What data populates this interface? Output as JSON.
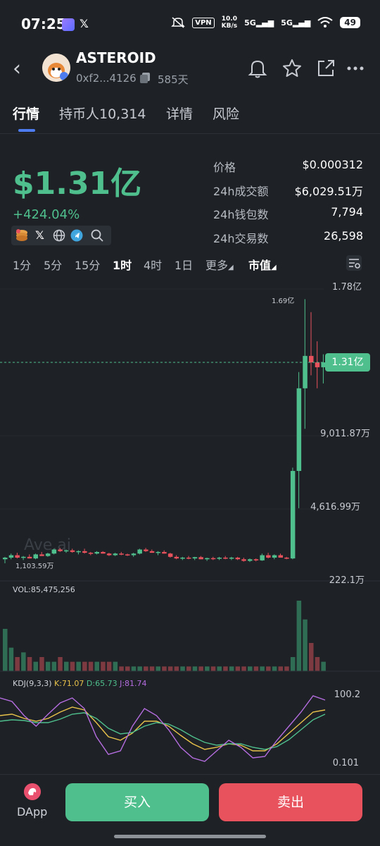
{
  "status_bar": {
    "time": "07:25",
    "vpn": "VPN",
    "net_speed": "10.0",
    "net_unit": "KB/s",
    "sig1": "5G",
    "sig2": "5G",
    "battery": "49",
    "icons": [
      "app-icon",
      "x-icon",
      "mute-icon",
      "signal-icon",
      "wifi-icon",
      "battery-icon"
    ]
  },
  "header": {
    "token_name": "ASTEROID",
    "address": "0xf2...4126",
    "age": "585天",
    "icons": [
      "back-icon",
      "bell-icon",
      "star-icon",
      "share-icon",
      "more-icon"
    ]
  },
  "tabs": [
    {
      "label": "行情",
      "active": true
    },
    {
      "label": "持币人10,314",
      "active": false
    },
    {
      "label": "详情",
      "active": false
    },
    {
      "label": "风险",
      "active": false
    }
  ],
  "summary": {
    "market_cap": "$1.31亿",
    "change": "+424.04%",
    "stats": [
      {
        "label": "价格",
        "value": "$0.000312"
      },
      {
        "label": "24h成交额",
        "value": "$6,029.51万"
      },
      {
        "label": "24h钱包数",
        "value": "7,794"
      },
      {
        "label": "24h交易数",
        "value": "26,598"
      }
    ],
    "social_icons": [
      "coin-stack-icon",
      "x-icon",
      "globe-icon",
      "telegram-icon",
      "search-icon"
    ]
  },
  "intervals": [
    {
      "label": "1分",
      "active": false
    },
    {
      "label": "5分",
      "active": false
    },
    {
      "label": "15分",
      "active": false
    },
    {
      "label": "1时",
      "active": true
    },
    {
      "label": "4时",
      "active": false
    },
    {
      "label": "1日",
      "active": false
    },
    {
      "label": "更多",
      "active": false
    }
  ],
  "metric_select": "市值",
  "chart_data": {
    "type": "candlestick",
    "y_axis_labels": [
      "1.78亿",
      "9,011.87万",
      "4,616.99万",
      "222.1万"
    ],
    "y_axis_values_wan": [
      17800,
      9011.87,
      4616.99,
      222.1
    ],
    "current_value_label": "1.31亿",
    "high_label": "1.69亿",
    "low_label": "1,103.59万",
    "watermark": "Ave.ai",
    "colors": {
      "up": "#4fc08d",
      "down": "#e8525d"
    },
    "candles_wan": [
      [
        950,
        1100,
        700,
        1050
      ],
      [
        1050,
        1300,
        950,
        1200
      ],
      [
        1200,
        1350,
        1000,
        1050
      ],
      [
        1050,
        1150,
        900,
        1100
      ],
      [
        1100,
        1250,
        1000,
        1000
      ],
      [
        1000,
        1300,
        950,
        1250
      ],
      [
        1250,
        1400,
        1150,
        1150
      ],
      [
        1150,
        1350,
        1100,
        1300
      ],
      [
        1300,
        1600,
        1250,
        1550
      ],
      [
        1550,
        1650,
        1400,
        1450
      ],
      [
        1450,
        1550,
        1350,
        1500
      ],
      [
        1500,
        1600,
        1350,
        1400
      ],
      [
        1400,
        1500,
        1250,
        1450
      ],
      [
        1450,
        1600,
        1300,
        1350
      ],
      [
        1350,
        1400,
        1200,
        1300
      ],
      [
        1300,
        1450,
        1250,
        1400
      ],
      [
        1400,
        1450,
        1300,
        1300
      ],
      [
        1300,
        1350,
        1150,
        1200
      ],
      [
        1200,
        1350,
        1150,
        1300
      ],
      [
        1300,
        1400,
        1200,
        1250
      ],
      [
        1250,
        1300,
        1150,
        1200
      ],
      [
        1200,
        1350,
        1100,
        1300
      ],
      [
        1300,
        1600,
        1250,
        1550
      ],
      [
        1550,
        1650,
        1400,
        1450
      ],
      [
        1450,
        1550,
        1350,
        1350
      ],
      [
        1350,
        1450,
        1200,
        1400
      ],
      [
        1400,
        1500,
        1300,
        1300
      ],
      [
        1300,
        1350,
        1050,
        1100
      ],
      [
        1100,
        1200,
        950,
        1000
      ],
      [
        1000,
        1100,
        900,
        1050
      ],
      [
        1050,
        1150,
        950,
        1000
      ],
      [
        1000,
        1100,
        900,
        1080
      ],
      [
        1080,
        1150,
        950,
        950
      ],
      [
        950,
        1050,
        850,
        1020
      ],
      [
        1020,
        1100,
        900,
        980
      ],
      [
        980,
        1100,
        900,
        1050
      ],
      [
        1050,
        1150,
        950,
        1000
      ],
      [
        1000,
        1100,
        900,
        1050
      ],
      [
        1050,
        1100,
        900,
        950
      ],
      [
        950,
        1050,
        800,
        850
      ],
      [
        850,
        1000,
        780,
        950
      ],
      [
        950,
        1000,
        820,
        880
      ],
      [
        880,
        1300,
        850,
        1200
      ],
      [
        1200,
        1350,
        1000,
        1050
      ],
      [
        1050,
        1250,
        950,
        1200
      ],
      [
        1200,
        1300,
        1050,
        1050
      ],
      [
        1050,
        1100,
        950,
        1000
      ],
      [
        1000,
        6600,
        950,
        6400
      ],
      [
        6400,
        12500,
        4100,
        11500
      ],
      [
        11500,
        17000,
        9000,
        13500
      ],
      [
        13500,
        16200,
        12300,
        13100
      ],
      [
        13100,
        14400,
        11500,
        12800
      ],
      [
        12800,
        13600,
        11800,
        13100
      ]
    ],
    "volume_label": "VOL:85,475,256",
    "volume": [
      9,
      5,
      3,
      4,
      3,
      2,
      3,
      2,
      2,
      3,
      2,
      2,
      2,
      2,
      2,
      2,
      2,
      2,
      2,
      1,
      1,
      1,
      1,
      1,
      1,
      1,
      1,
      1,
      1,
      1,
      1,
      1,
      1,
      1,
      1,
      1,
      1,
      1,
      1,
      1,
      1,
      1,
      1,
      1,
      1,
      1,
      1,
      3,
      15,
      11,
      6,
      3,
      2
    ],
    "kdj_label": "KDJ(9,3,3)",
    "kdj_values": {
      "K": "K:71.07",
      "D": "D:65.73",
      "J": "J:81.74"
    },
    "kdj_axis": [
      "100.2",
      "0.101"
    ]
  },
  "bottom": {
    "dapp_label": "DApp",
    "buy_label": "买入",
    "sell_label": "卖出"
  }
}
